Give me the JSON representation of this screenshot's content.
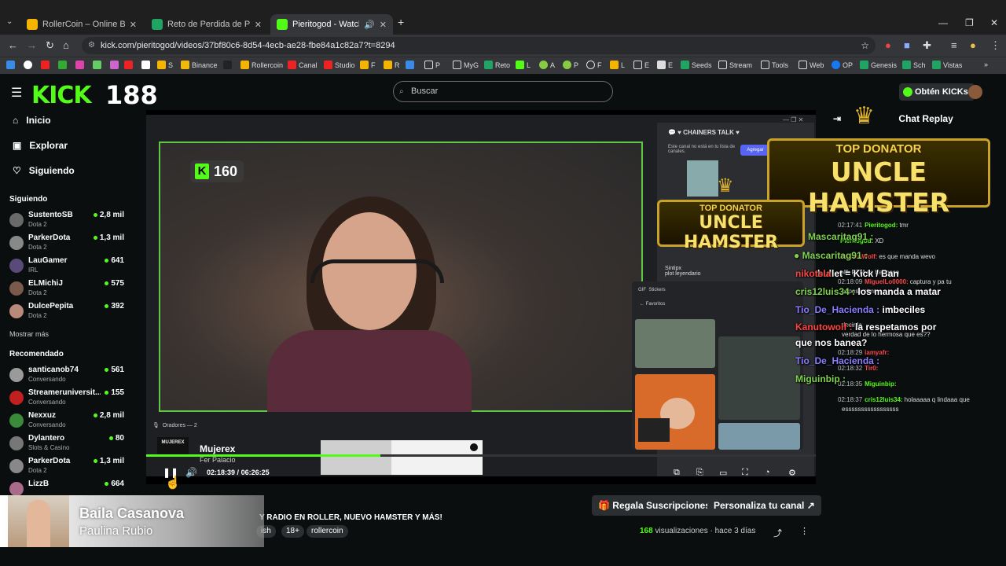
{
  "browser": {
    "tabs": [
      {
        "title": "RollerCoin – Online Bitcoin Mini",
        "color": "#f5b400",
        "active": false
      },
      {
        "title": "Reto de Perdida de Peso - El M",
        "color": "#1fa463",
        "active": false
      },
      {
        "title": "Pieritogod - Watch the VOD",
        "color": "#53fc18",
        "active": true
      }
    ],
    "url": "kick.com/pieritogod/videos/37bf80c6-8d54-4ecb-ae28-fbe84a1c82a7?t=8294",
    "bookmarks": [
      "Binance",
      "Rollercoin",
      "Canal",
      "Studio",
      "F",
      "R",
      "P",
      "MyG",
      "Reto",
      "L",
      "A",
      "P",
      "F",
      "L",
      "E",
      "E",
      "Seeds",
      "Stream",
      "Tools",
      "Web",
      "OP",
      "Genesis",
      "Sch",
      "Vistas"
    ]
  },
  "header": {
    "logo": "KICK",
    "logo_count": "188",
    "search_placeholder": "Buscar",
    "kicks_button": "Obtén KICKs"
  },
  "sidebar": {
    "nav": [
      "Inicio",
      "Explorar",
      "Siguiendo"
    ],
    "following_title": "Siguiendo",
    "following": [
      {
        "name": "SustentoSB",
        "category": "Dota 2",
        "viewers": "2,8 mil",
        "color": "#6a6a6a"
      },
      {
        "name": "ParkerDota",
        "category": "Dota 2",
        "viewers": "1,3 mil",
        "color": "#888888"
      },
      {
        "name": "LauGamer",
        "category": "IRL",
        "viewers": "641",
        "color": "#5a4a7a"
      },
      {
        "name": "ELMichiJ",
        "category": "Dota 2",
        "viewers": "575",
        "color": "#7a5a4a"
      },
      {
        "name": "DulcePepita",
        "category": "Dota 2",
        "viewers": "392",
        "color": "#b98a7a"
      }
    ],
    "show_more": "Mostrar más",
    "recommended_title": "Recomendado",
    "recommended": [
      {
        "name": "santicanob74",
        "category": "Conversando",
        "viewers": "561",
        "color": "#9a9a9a"
      },
      {
        "name": "Streameruniversit...",
        "category": "Conversando",
        "viewers": "155",
        "color": "#c02020"
      },
      {
        "name": "Nexxuz",
        "category": "Conversando",
        "viewers": "2,8 mil",
        "color": "#3a8a3a"
      },
      {
        "name": "Dylantero",
        "category": "Slots & Casino",
        "viewers": "80",
        "color": "#777777"
      },
      {
        "name": "ParkerDota",
        "category": "Dota 2",
        "viewers": "1,3 mil",
        "color": "#888888"
      },
      {
        "name": "LizzB",
        "category": "",
        "viewers": "664",
        "color": "#aa6a8a"
      }
    ]
  },
  "video": {
    "cam_counter": "160",
    "discord_channel": "CHAINERS TALK",
    "discord_notice": "Este canal no está en tu lista de canales.",
    "discord_add": "Agregar",
    "stickers_tab": "GIF",
    "favorites": "Favoritos",
    "speakers": "Oradores — 2",
    "song_box": "MUJEREX",
    "song_title": "Mujerex",
    "song_artist": "Fer Palacio",
    "progress_fraction": 0.35,
    "time_current": "02:18:39",
    "time_sep": "/",
    "time_total": "06:26:25",
    "title_fragment": "Y RADIO EN ROLLER, NUEVO HAMSTER Y MÁS!",
    "tags": [
      "ish",
      "18+",
      "rollercoin"
    ],
    "subs_button": "Regala Suscripciones",
    "custom_button": "Personaliza tu canal",
    "views_count": "168",
    "views_label": "visualizaciones",
    "age": "hace 3 días"
  },
  "overlay": {
    "banner_top": "TOP DONATOR",
    "banner_name": "UNCLE HAMSTER",
    "messages": [
      {
        "user": "Mascaritag91 :",
        "text": "",
        "color": "#7fd34e"
      },
      {
        "user": "Mascaritag91 :",
        "text": "",
        "color": "#7fd34e"
      },
      {
        "user": "bullet :",
        "text": "bullet = Kick / Ban",
        "color": "#ffffff"
      },
      {
        "user": "nikotsla :",
        "text": "bullet = Kick / Ban",
        "color": "#ff4444"
      },
      {
        "user": "cris12luis34 :",
        "text": "los manda a matar",
        "color": "#7fd34e"
      },
      {
        "user": "Tio_De_Hacienda :",
        "text": "imbeciles",
        "color": "#8a7cff"
      },
      {
        "user": "Kanutowolf :",
        "text": "la respetamos por",
        "color": "#ff4444"
      },
      {
        "user": "",
        "text": "que nos banea?",
        "color": "#ffffff"
      },
      {
        "user": "Tio_De_Hacienda :",
        "text": "",
        "color": "#8a7cff"
      },
      {
        "user": "Miguinbip :",
        "text": "",
        "color": "#7fd34e"
      }
    ]
  },
  "chat": {
    "header": "Chat Replay",
    "messages": [
      {
        "time": "02:17:41",
        "user": "Pieritogod:",
        "text": "tmr",
        "color": "#53fc18"
      },
      {
        "time": "",
        "user": "Pieritogod:",
        "text": "XD",
        "color": "#53fc18"
      },
      {
        "time": "",
        "user": "KanutoWolf:",
        "text": "es que manda wevo",
        "color": "#ff4444"
      },
      {
        "time": "",
        "user": "olf:",
        "text": "PTM es hermosa",
        "color": "#bbbbbb"
      },
      {
        "time": "02:18:09",
        "user": "MiguelLo0000:",
        "text": "captura y pa tu",
        "color": "#ff4444"
      },
      {
        "time": "",
        "user": "",
        "text": "esposa ctmr",
        "color": "#bbbbbb"
      },
      {
        "time": "",
        "user": "",
        "text": "decir la",
        "color": "#bbbbbb"
      },
      {
        "time": "",
        "user": "",
        "text": "verdad de lo hermosa que es??",
        "color": "#bbbbbb"
      },
      {
        "time": "02:18:29",
        "user": "iamyafr:",
        "text": "",
        "color": "#ff4444"
      },
      {
        "time": "02:18:32",
        "user": "Tir0:",
        "text": "",
        "color": "#ff4444"
      },
      {
        "time": "02:18:35",
        "user": "Miguinbip:",
        "text": "",
        "color": "#53fc18"
      },
      {
        "time": "02:18:37",
        "user": "cris12luis34:",
        "text": "holaaaaa q lindaaa que",
        "color": "#53fc18"
      },
      {
        "time": "",
        "user": "",
        "text": "esssssssssssssssss",
        "color": "#dddddd"
      }
    ]
  },
  "music": {
    "title": "Baila Casanova",
    "artist": "Paulina Rubio"
  },
  "colors": {
    "brand": "#53fc18",
    "background": "#0b0e0f"
  }
}
